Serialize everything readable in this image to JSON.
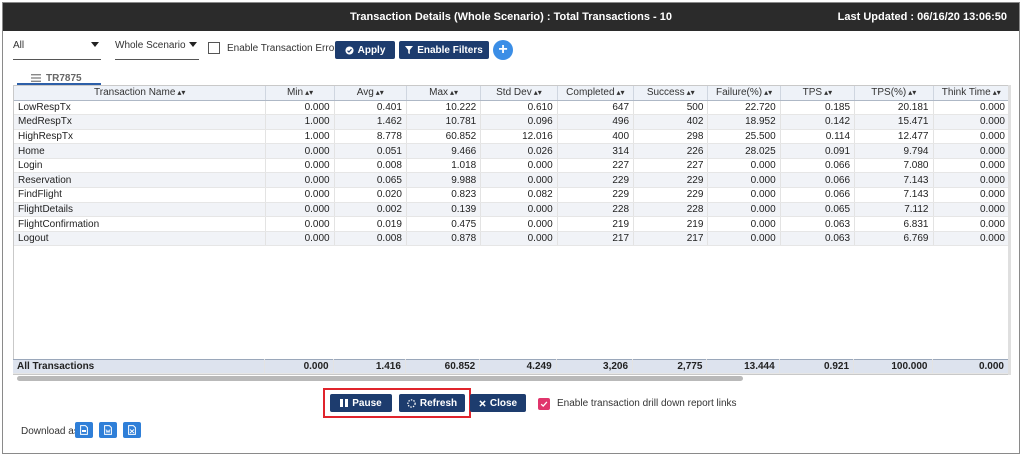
{
  "window": {
    "title": "Transaction Details (Whole Scenario) : Total Transactions - 10",
    "last_updated": "Last Updated : 06/16/20 13:06:50"
  },
  "filters": {
    "group_select": "All",
    "scenario_select": "Whole Scenario",
    "errors_label": "Enable Transaction Errors",
    "apply_label": "Apply",
    "enable_filters_label": "Enable Filters",
    "add_label": "+"
  },
  "tab": {
    "label": "TR7875"
  },
  "table": {
    "columns": [
      "Transaction Name",
      "Min",
      "Avg",
      "Max",
      "Std Dev",
      "Completed",
      "Success",
      "Failure(%)",
      "TPS",
      "TPS(%)",
      "Think Time"
    ],
    "rows": [
      [
        "LowRespTx",
        "0.000",
        "0.401",
        "10.222",
        "0.610",
        "647",
        "500",
        "22.720",
        "0.185",
        "20.181",
        "0.000"
      ],
      [
        "MedRespTx",
        "1.000",
        "1.462",
        "10.781",
        "0.096",
        "496",
        "402",
        "18.952",
        "0.142",
        "15.471",
        "0.000"
      ],
      [
        "HighRespTx",
        "1.000",
        "8.778",
        "60.852",
        "12.016",
        "400",
        "298",
        "25.500",
        "0.114",
        "12.477",
        "0.000"
      ],
      [
        "Home",
        "0.000",
        "0.051",
        "9.466",
        "0.026",
        "314",
        "226",
        "28.025",
        "0.091",
        "9.794",
        "0.000"
      ],
      [
        "Login",
        "0.000",
        "0.008",
        "1.018",
        "0.000",
        "227",
        "227",
        "0.000",
        "0.066",
        "7.080",
        "0.000"
      ],
      [
        "Reservation",
        "0.000",
        "0.065",
        "9.988",
        "0.000",
        "229",
        "229",
        "0.000",
        "0.066",
        "7.143",
        "0.000"
      ],
      [
        "FindFlight",
        "0.000",
        "0.020",
        "0.823",
        "0.082",
        "229",
        "229",
        "0.000",
        "0.066",
        "7.143",
        "0.000"
      ],
      [
        "FlightDetails",
        "0.000",
        "0.002",
        "0.139",
        "0.000",
        "228",
        "228",
        "0.000",
        "0.065",
        "7.112",
        "0.000"
      ],
      [
        "FlightConfirmation",
        "0.000",
        "0.019",
        "0.475",
        "0.000",
        "219",
        "219",
        "0.000",
        "0.063",
        "6.831",
        "0.000"
      ],
      [
        "Logout",
        "0.000",
        "0.008",
        "0.878",
        "0.000",
        "217",
        "217",
        "0.000",
        "0.063",
        "6.769",
        "0.000"
      ]
    ],
    "totals": [
      "All Transactions",
      "0.000",
      "1.416",
      "60.852",
      "4.249",
      "3,206",
      "2,775",
      "13.444",
      "0.921",
      "100.000",
      "0.000"
    ]
  },
  "actions": {
    "pause_label": "Pause",
    "refresh_label": "Refresh",
    "close_label": "Close",
    "drilldown_label": "Enable transaction drill down report links"
  },
  "download": {
    "label": "Download as",
    "formats": [
      "pdf-icon",
      "word-icon",
      "excel-icon"
    ]
  },
  "colors": {
    "titlebar": "#2b2b2b",
    "button": "#1d3c6e",
    "accent": "#3b8ee6",
    "highlight_box": "#e0242c",
    "checkbox_checked": "#e0356c"
  }
}
